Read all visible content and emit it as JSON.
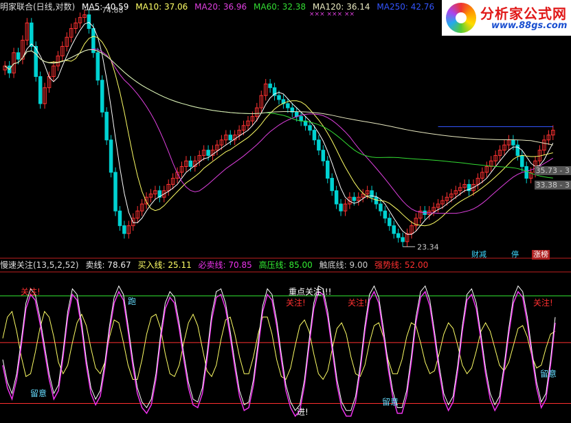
{
  "upper_legend": {
    "title": "明家联合(日线,对数)",
    "ma5": "MA5: 40.59",
    "ma10": "MA10: 37.06",
    "ma20": "MA20: 36.96",
    "ma60": "MA60: 32.38",
    "ma120": "MA120: 36.14",
    "ma250": "MA250: 42.76",
    "marks": "×××  ×××   ××"
  },
  "lower_legend": {
    "title": "慢速关注(13,5,2,52)",
    "sell": "卖线: 78.67",
    "buy": "买入线: 25.11",
    "must_sell": "必卖线: 70.85",
    "pressure": "高压线: 85.00",
    "bottom": "触底线: 9.00",
    "strong": "强势线: 52.00"
  },
  "logo": {
    "name": "分析家公式网",
    "site": "www.88gs.com"
  },
  "badges": {
    "cai": "财减",
    "ting": "停",
    "zhang": "涨榜"
  },
  "right_labels": {
    "r1": "35.73 - 3",
    "r2": "33.38 - 3"
  },
  "colors": {
    "up": "#ff3232",
    "down": "#00d2d2",
    "ma5": "#ffffff",
    "ma10": "#ffff66",
    "ma20": "#e040e0",
    "ma60": "#33dd33",
    "ma120": "#e8e8c0",
    "ma250": "#3355ff",
    "red": "#ff3030",
    "green": "#33ee33",
    "yellow": "#ffff66",
    "magenta": "#ee33ee"
  },
  "chart_data": [
    {
      "type": "candlestick",
      "title": "明家联合(日线,对数)",
      "y_range": [
        23.34,
        74.88
      ],
      "annotations": {
        "high": "74.88",
        "low": "23.34"
      },
      "close": [
        58,
        56,
        62,
        60,
        66,
        72,
        64,
        55,
        48,
        52,
        55,
        58,
        61,
        64,
        67,
        70,
        72,
        74,
        75,
        70,
        62,
        54,
        46,
        40,
        34,
        28,
        26,
        25,
        26,
        27,
        28,
        29,
        30,
        30.5,
        31,
        30,
        31,
        32,
        33,
        34,
        35,
        36,
        35,
        36,
        37,
        38,
        37,
        38,
        39,
        40,
        41,
        40,
        41,
        42,
        43,
        44,
        45,
        47,
        50,
        53,
        52,
        50,
        49,
        48,
        47,
        46,
        45,
        44,
        43,
        42,
        40,
        38,
        36,
        33,
        31,
        29,
        28,
        29,
        30,
        29.5,
        30,
        30.5,
        31,
        30,
        29,
        28,
        27,
        26,
        25,
        24.5,
        24,
        25,
        26,
        27,
        28,
        27.5,
        28,
        28.5,
        29,
        29.5,
        30,
        30.5,
        31,
        31.5,
        32,
        31,
        32,
        33,
        34,
        35,
        36,
        37,
        38,
        39,
        40,
        39,
        37,
        35,
        33,
        34,
        36,
        38,
        40,
        41,
        42
      ],
      "series": [
        {
          "name": "MA5",
          "value": "40.59"
        },
        {
          "name": "MA10",
          "value": "37.06"
        },
        {
          "name": "MA20",
          "value": "36.96"
        },
        {
          "name": "MA60",
          "value": "32.38"
        },
        {
          "name": "MA120",
          "value": "36.14"
        },
        {
          "name": "MA250",
          "value": "42.76"
        }
      ],
      "grid": false
    },
    {
      "type": "line",
      "title": "慢速关注(13,5,2,52)",
      "ylim": [
        0,
        100
      ],
      "reference_lines": {
        "高压线": 85,
        "强势线": 52,
        "触底线": 9
      },
      "series": [
        {
          "name": "卖线",
          "values": [
            40,
            24,
            16,
            30,
            54,
            80,
            90,
            86,
            70,
            50,
            30,
            16,
            22,
            46,
            74,
            90,
            86,
            66,
            40,
            20,
            12,
            18,
            38,
            64,
            84,
            92,
            86,
            64,
            40,
            20,
            10,
            6,
            12,
            30,
            58,
            80,
            88,
            84,
            66,
            44,
            24,
            12,
            10,
            20,
            44,
            72,
            88,
            90,
            80,
            60,
            38,
            18,
            8,
            10,
            26,
            52,
            78,
            90,
            86,
            68,
            44,
            22,
            10,
            4,
            8,
            26,
            54,
            80,
            92,
            90,
            74,
            50,
            26,
            10,
            4,
            4,
            14,
            36,
            64,
            86,
            92,
            84,
            62,
            38,
            18,
            6,
            6,
            18,
            42,
            70,
            88,
            92,
            82,
            60,
            36,
            16,
            8,
            14,
            36,
            64,
            86,
            90,
            80,
            58,
            34,
            16,
            8,
            14,
            36,
            62,
            84,
            92,
            88,
            70,
            46,
            24,
            10,
            16,
            40,
            70
          ],
          "value": "78.67"
        },
        {
          "name": "买入线",
          "values": [
            55,
            70,
            74,
            60,
            42,
            28,
            30,
            45,
            62,
            74,
            70,
            56,
            38,
            30,
            36,
            52,
            66,
            72,
            64,
            48,
            34,
            30,
            38,
            56,
            68,
            66,
            52,
            36,
            26,
            26,
            40,
            58,
            70,
            72,
            62,
            44,
            30,
            28,
            36,
            52,
            66,
            72,
            64,
            48,
            32,
            28,
            36,
            54,
            68,
            70,
            58,
            42,
            30,
            30,
            42,
            58,
            70,
            70,
            58,
            40,
            28,
            26,
            34,
            50,
            64,
            68,
            60,
            44,
            30,
            26,
            32,
            48,
            62,
            66,
            58,
            42,
            30,
            28,
            36,
            52,
            64,
            66,
            56,
            40,
            30,
            30,
            40,
            56,
            66,
            64,
            52,
            38,
            30,
            32,
            44,
            58,
            66,
            62,
            50,
            36,
            30,
            34,
            46,
            60,
            66,
            60,
            48,
            36,
            32,
            38,
            50,
            62,
            64,
            56,
            42,
            34,
            36,
            48,
            58,
            60
          ],
          "value": "25.11"
        }
      ],
      "labels": [
        "关注!",
        "跑",
        "留意",
        "关注!",
        "重点关注!!!",
        "进!",
        "关注!",
        "留意",
        "关注!",
        "留意"
      ],
      "grid": false
    }
  ]
}
